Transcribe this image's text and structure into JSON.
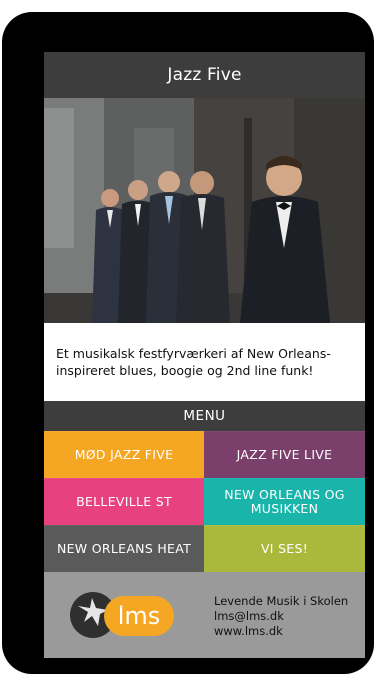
{
  "header": {
    "title": "Jazz Five"
  },
  "hero": {
    "alt": "Band photo"
  },
  "tagline": {
    "line1": "Et musikalsk festfyrværkeri af New Orleans-",
    "line2": "inspireret blues, boogie og 2nd line funk!"
  },
  "menu": {
    "label": "MENU",
    "items": [
      {
        "label": "MØD JAZZ FIVE",
        "color": "#f5a623"
      },
      {
        "label": "JAZZ FIVE LIVE",
        "color": "#7b3f6b"
      },
      {
        "label": "BELLEVILLE ST",
        "color": "#e8417f"
      },
      {
        "label_line1": "NEW ORLEANS OG",
        "label_line2": "MUSIKKEN",
        "color": "#19b5ab"
      },
      {
        "label": "NEW ORLEANS HEAT",
        "color": "#5a5a5a"
      },
      {
        "label": "VI SES!",
        "color": "#aab83b"
      }
    ]
  },
  "footer": {
    "logo_text": "lms",
    "org": "Levende Musik i Skolen",
    "email": "lms@lms.dk",
    "web": "www.lms.dk"
  },
  "colors": {
    "header_bg": "#3d3d3d",
    "footer_bg": "#9a9a9a",
    "logo_orange": "#f5a623"
  }
}
